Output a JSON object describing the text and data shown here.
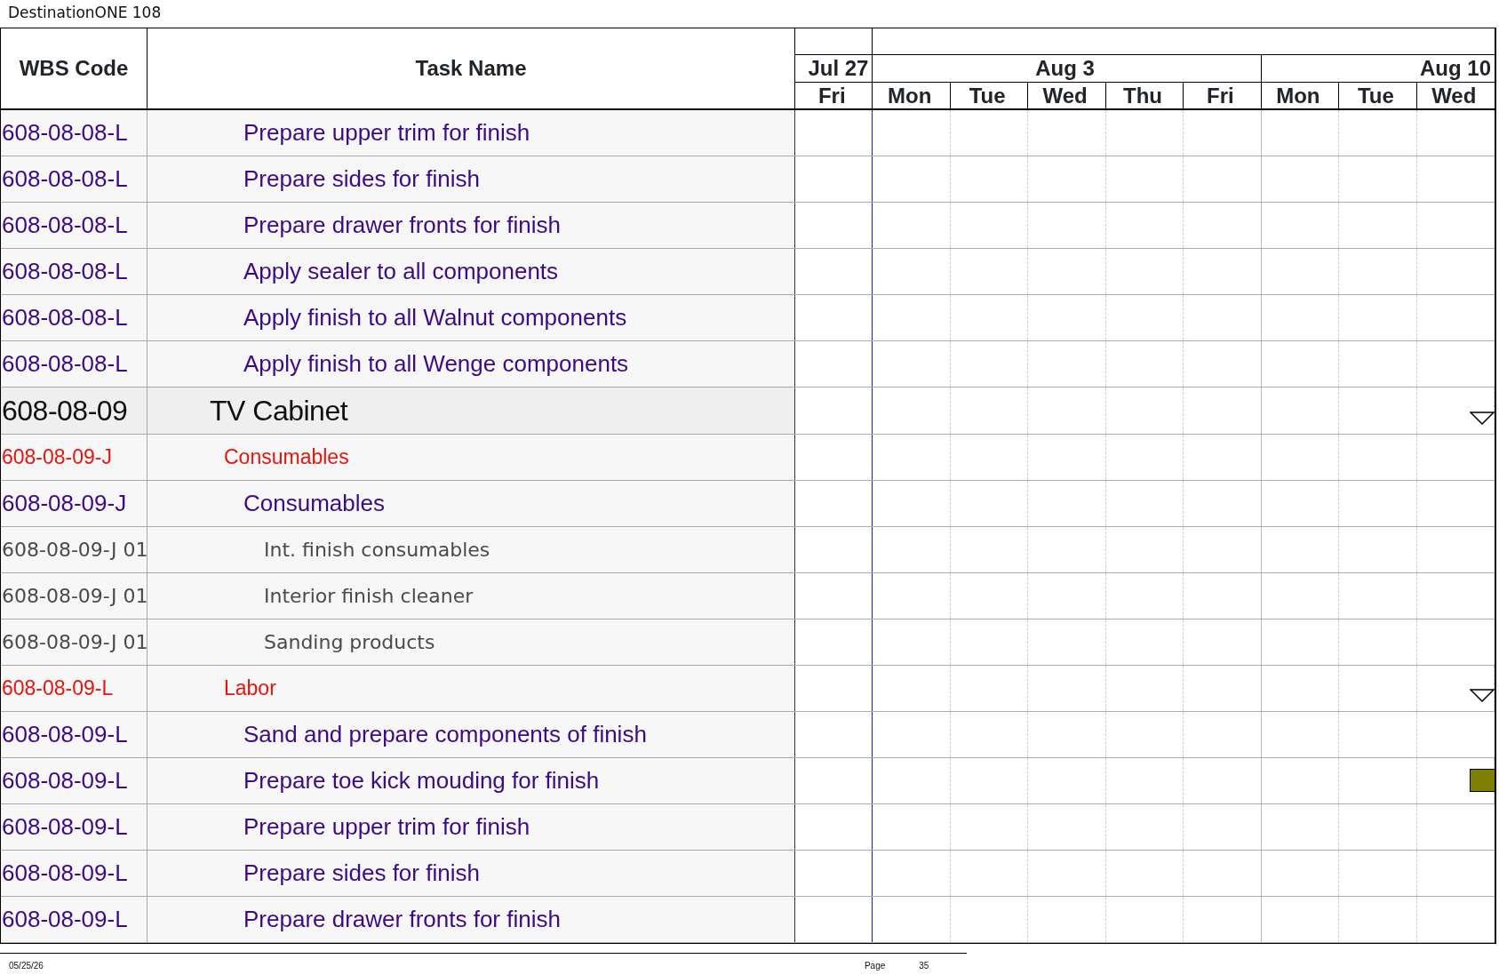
{
  "document_title": "DestinationONE 108",
  "columns": [
    "WBS Code",
    "Task Name"
  ],
  "timeline": {
    "months": [
      {
        "label": "Jul 27",
        "days": [
          "Fri"
        ]
      },
      {
        "label": "Aug 3",
        "days": [
          "Mon",
          "Tue",
          "Wed",
          "Thu",
          "Fri"
        ]
      },
      {
        "label": "Aug 10",
        "days": [
          "Mon",
          "Tue",
          "Wed"
        ]
      }
    ]
  },
  "rows": [
    {
      "kind": "task",
      "wbs": "608-08-08-L",
      "name": "Prepare upper trim for finish"
    },
    {
      "kind": "task",
      "wbs": "608-08-08-L",
      "name": "Prepare sides for finish"
    },
    {
      "kind": "task",
      "wbs": "608-08-08-L",
      "name": "Prepare drawer fronts for finish"
    },
    {
      "kind": "task",
      "wbs": "608-08-08-L",
      "name": "Apply sealer to all components"
    },
    {
      "kind": "task",
      "wbs": "608-08-08-L",
      "name": "Apply finish to all Walnut components"
    },
    {
      "kind": "task",
      "wbs": "608-08-08-L",
      "name": "Apply finish to all Wenge components"
    },
    {
      "kind": "summary",
      "wbs": "608-08-09",
      "name": "TV Cabinet",
      "marker": {
        "kind": "summary"
      }
    },
    {
      "kind": "group",
      "wbs": "608-08-09-J",
      "name": "Consumables"
    },
    {
      "kind": "task",
      "wbs": "608-08-09-J",
      "name": "Consumables"
    },
    {
      "kind": "item",
      "wbs": "608-08-09-J 01",
      "name": "Int. finish consumables"
    },
    {
      "kind": "item",
      "wbs": "608-08-09-J 01",
      "name": "Interior finish cleaner"
    },
    {
      "kind": "item",
      "wbs": "608-08-09-J 01",
      "name": "Sanding products"
    },
    {
      "kind": "group",
      "wbs": "608-08-09-L",
      "name": "Labor",
      "marker": {
        "kind": "summary"
      }
    },
    {
      "kind": "task",
      "wbs": "608-08-09-L",
      "name": "Sand and prepare components of finish"
    },
    {
      "kind": "task",
      "wbs": "608-08-09-L",
      "name": "Prepare toe kick mouding for finish",
      "marker": {
        "kind": "bar"
      }
    },
    {
      "kind": "task",
      "wbs": "608-08-09-L",
      "name": "Prepare upper trim for finish"
    },
    {
      "kind": "task",
      "wbs": "608-08-09-L",
      "name": "Prepare sides for finish"
    },
    {
      "kind": "task",
      "wbs": "608-08-09-L",
      "name": "Prepare drawer fronts for finish"
    }
  ],
  "footer": {
    "date": "05/25/26",
    "page_label": "Page",
    "page_number": "35"
  }
}
